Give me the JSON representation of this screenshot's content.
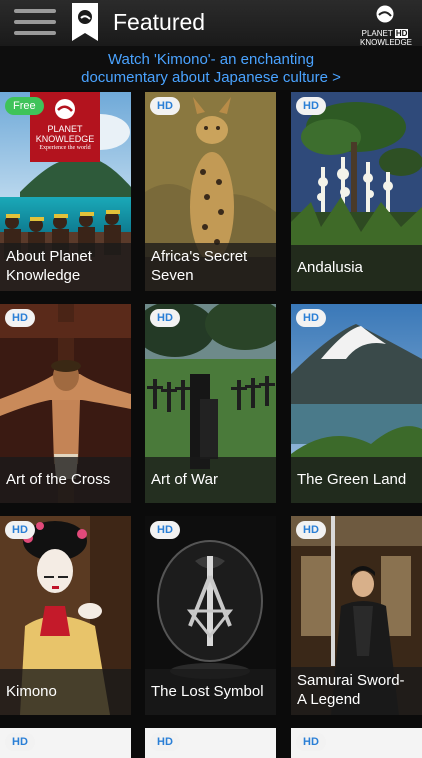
{
  "header": {
    "title": "Featured",
    "brand_line1": "PLANET",
    "brand_hd": "HD",
    "brand_line2": "KNOWLEDGE",
    "accent_color": "#4aa3ff"
  },
  "promo": {
    "line1": "Watch 'Kimono'- an enchanting",
    "line2": "documentary about Japanese culture >"
  },
  "tiles": [
    {
      "title": "About Planet Knowledge",
      "badge": "Free"
    },
    {
      "title": "Africa's Secret Seven",
      "badge": "HD"
    },
    {
      "title": "Andalusia",
      "badge": "HD"
    },
    {
      "title": "Art of the Cross",
      "badge": "HD"
    },
    {
      "title": "Art of War",
      "badge": "HD"
    },
    {
      "title": "The Green Land",
      "badge": "HD"
    },
    {
      "title": "Kimono",
      "badge": "HD"
    },
    {
      "title": "The Lost Symbol",
      "badge": "HD"
    },
    {
      "title": "Samurai Sword- A Legend",
      "badge": "HD"
    },
    {
      "title": "",
      "badge": "HD"
    },
    {
      "title": "",
      "badge": "HD"
    },
    {
      "title": "",
      "badge": "HD"
    }
  ],
  "planet_logo": {
    "line1": "PLANET",
    "line2": "KNOWLEDGE",
    "tagline": "Experience the world"
  }
}
